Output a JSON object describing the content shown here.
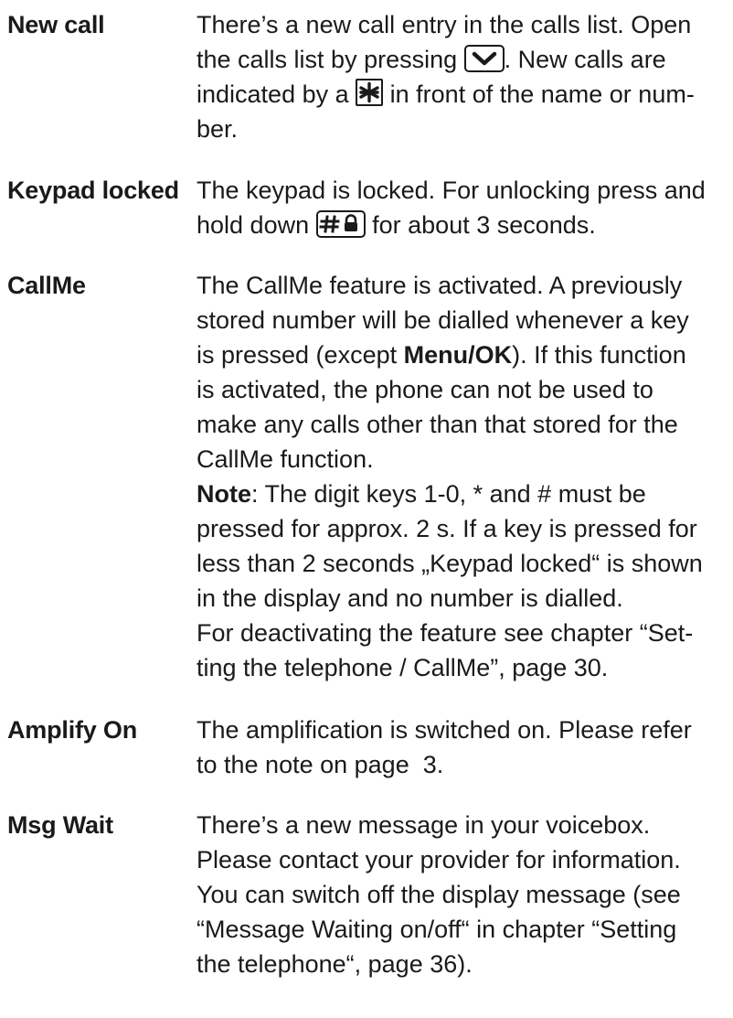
{
  "entries": [
    {
      "term": "New call",
      "lines": [
        "There’s a new call entry in the calls list. Open",
        "the calls list by pressing",
        ". New calls are",
        "indicated by a",
        "in front of the name or num-",
        "ber."
      ]
    },
    {
      "term": "Keypad locked",
      "lines": [
        "The keypad is locked. For unlocking press and",
        "hold down",
        "for about 3 seconds."
      ]
    },
    {
      "term": "CallMe",
      "lines": [
        "The CallMe feature is activated. A previously",
        "stored number will be dialled whenever a key",
        "is pressed (except",
        "Menu/OK",
        "). If this function",
        "is activated, the phone can not be used to",
        "make any calls other than that stored for the",
        "CallMe function.",
        "Note",
        ": The digit keys 1-0, * and # must be",
        "pressed for approx. 2 s. If a key is pressed for",
        "less than 2 seconds „Keypad locked“ is shown",
        "in the display and no number is dialled.",
        "For deactivating the feature see chapter “Set-",
        "ting the telephone / CallMe”, page 30."
      ]
    },
    {
      "term": "Amplify On",
      "lines": [
        "The amplification is switched on. Please refer",
        "to the note on page  3."
      ]
    },
    {
      "term": "Msg Wait",
      "lines": [
        "There’s a new message in your voicebox.",
        "Please contact your provider for information.",
        "You can switch off the display message (see",
        "“Message Waiting on/off“ in chapter “Setting",
        "the telephone“, page 36)."
      ]
    }
  ],
  "icons": {
    "down_key": "chevron-down-key-icon",
    "star_key": "star-key-icon",
    "hash_lock_key": "hash-lock-key-icon"
  },
  "colors": {
    "text": "#1a1a1a",
    "background": "#ffffff"
  }
}
